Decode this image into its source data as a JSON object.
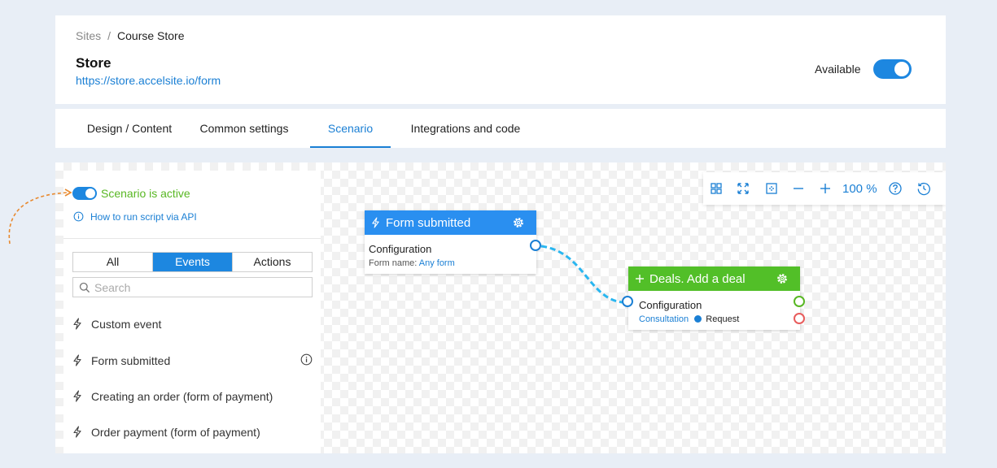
{
  "breadcrumb": {
    "parent": "Sites",
    "separator": "/",
    "current": "Course Store"
  },
  "site": {
    "title": "Store",
    "url": "https://store.accelsite.io/form"
  },
  "availability": {
    "label": "Available",
    "enabled": true
  },
  "tabs": [
    {
      "label": "Design / Content"
    },
    {
      "label": "Common settings"
    },
    {
      "label": "Scenario",
      "active": true
    },
    {
      "label": "Integrations and code"
    }
  ],
  "left_panel": {
    "scenario_status": "Scenario is active",
    "api_link": "How to run script via API",
    "filter": {
      "all": "All",
      "events": "Events",
      "actions": "Actions",
      "selected": "Events"
    },
    "search": {
      "placeholder": "Search",
      "value": ""
    },
    "events": [
      {
        "label": "Custom event"
      },
      {
        "label": "Form submitted"
      },
      {
        "label": "Creating an order (form of payment)"
      },
      {
        "label": "Order payment (form of payment)"
      }
    ]
  },
  "nodes": {
    "trigger": {
      "title": "Form submitted",
      "config_label": "Configuration",
      "sub_key": "Form name:",
      "sub_value": "Any form",
      "color": "#2a8ff0"
    },
    "action": {
      "title": "Deals. Add a deal",
      "config_label": "Configuration",
      "sub_value": "Consultation",
      "sub_tag": "Request",
      "color": "#52bf28"
    }
  },
  "toolbar": {
    "zoom": "100 %"
  },
  "colors": {
    "accent": "#1d87e0",
    "success": "#58b723",
    "danger": "#e85c5c",
    "connector": "#29b6f0",
    "hint_arrow": "#e88a30"
  }
}
